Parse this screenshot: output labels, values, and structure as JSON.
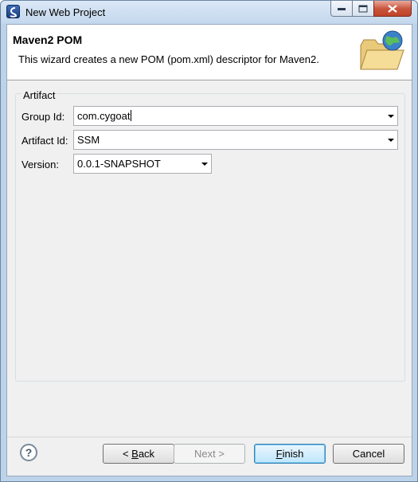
{
  "window": {
    "title": "New Web Project"
  },
  "banner": {
    "title": "Maven2 POM",
    "description": "This wizard creates a new POM (pom.xml) descriptor for Maven2."
  },
  "artifact_group": {
    "label": "Artifact",
    "group_id": {
      "label": "Group Id:",
      "value": "com.cygoat"
    },
    "artifact_id": {
      "label": "Artifact Id:",
      "value": "SSM"
    },
    "version": {
      "label": "Version:",
      "value": "0.0.1-SNAPSHOT"
    }
  },
  "buttons": {
    "help": "?",
    "back_prefix": "< ",
    "back_mnemonic": "B",
    "back_rest": "ack",
    "next": "Next >",
    "finish_mnemonic": "F",
    "finish_rest": "inish",
    "cancel": "Cancel"
  },
  "icons": {
    "app": "eclipse-app-icon",
    "banner": "folder-globe-icon",
    "minimize": "minimize-icon",
    "maximize": "maximize-icon",
    "close": "close-icon",
    "dropdown": "chevron-down-icon",
    "help": "help-icon"
  },
  "colors": {
    "titlebar": "#c3d7ed",
    "close_button": "#c8523a",
    "default_button": "#bee6fd"
  }
}
